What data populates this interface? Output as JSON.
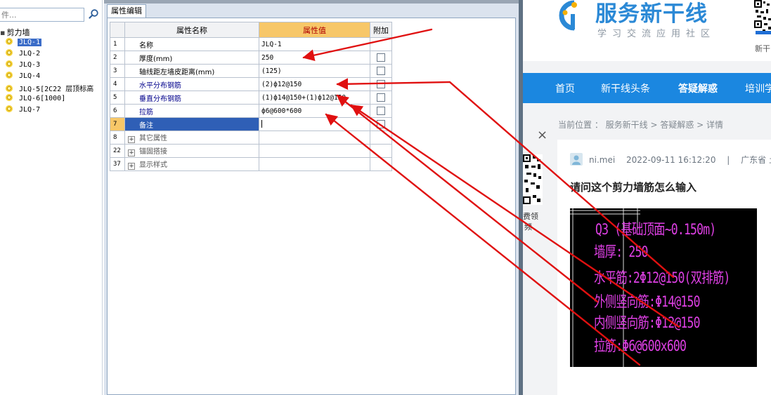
{
  "tree": {
    "search_placeholder": "件...",
    "root": "剪力墙",
    "items": [
      {
        "label": "JLQ-1",
        "selected": true
      },
      {
        "label": "JLQ-2",
        "selected": false
      },
      {
        "label": "JLQ-3",
        "selected": false
      },
      {
        "label": "JLQ-4",
        "selected": false
      },
      {
        "label": "JLQ-5[2C22 层顶标高",
        "selected": false
      },
      {
        "label": "JLQ-6[1000]",
        "selected": false
      },
      {
        "label": "JLQ-7",
        "selected": false
      }
    ]
  },
  "property_editor": {
    "tab_label": "属性编辑",
    "columns": {
      "name": "属性名称",
      "value": "属性值",
      "extra": "附加"
    },
    "rows": [
      {
        "num": "1",
        "name": "名称",
        "value": "JLQ-1",
        "checkbox": false
      },
      {
        "num": "2",
        "name": "厚度(mm)",
        "value": "250",
        "checkbox": true
      },
      {
        "num": "3",
        "name": "轴线距左墙皮距离(mm)",
        "value": "(125)",
        "checkbox": true
      },
      {
        "num": "4",
        "name": "水平分布钢筋",
        "value": "(2)ф12@150",
        "checkbox": true
      },
      {
        "num": "5",
        "name": "垂直分布钢筋",
        "value": "(1)ф14@150+(1)ф12@150",
        "checkbox": true
      },
      {
        "num": "6",
        "name": "拉筋",
        "value": "ф6@600*600",
        "checkbox": true
      },
      {
        "num": "7",
        "name": "备注",
        "value": "",
        "checkbox": true
      },
      {
        "num": "8",
        "name": "其它属性",
        "group": true
      },
      {
        "num": "22",
        "name": "锚固搭接",
        "group": true
      },
      {
        "num": "37",
        "name": "显示样式",
        "group": true
      }
    ]
  },
  "site": {
    "logo_title": "服务新干线",
    "logo_subtitle": "学习交流应用社区",
    "qr_caption": "新干",
    "nav": [
      "首页",
      "新干线头条",
      "答疑解惑",
      "培训学"
    ],
    "nav_active": "答疑解惑",
    "breadcrumb": "当前位置 ： 服务新干线 > 答疑解惑 > 详情",
    "close_label": "×",
    "side_qr_caption_1": "费领",
    "side_qr_caption_2": "频",
    "author": "ni.mei",
    "time": "2022-09-11 16:12:20",
    "separator": "|",
    "location": "广东省 土",
    "question_title": "请问这个剪力墙筋怎么输入",
    "cad_lines": [
      "Q3 (基础顶面~0.150m)",
      "墙厚: 250",
      "水平筋:2Φ12@150(双排筋)",
      "外侧竖向筋:Φ14@150",
      "内侧竖向筋:Φ12@150",
      "拉筋:Φ6@600x600"
    ]
  },
  "colors": {
    "accent_blue": "#1b87e0",
    "header_orange": "#f7c768",
    "selection_blue": "#2f5fb6",
    "annotation_red": "#e01010",
    "cad_magenta": "#e040e6"
  }
}
